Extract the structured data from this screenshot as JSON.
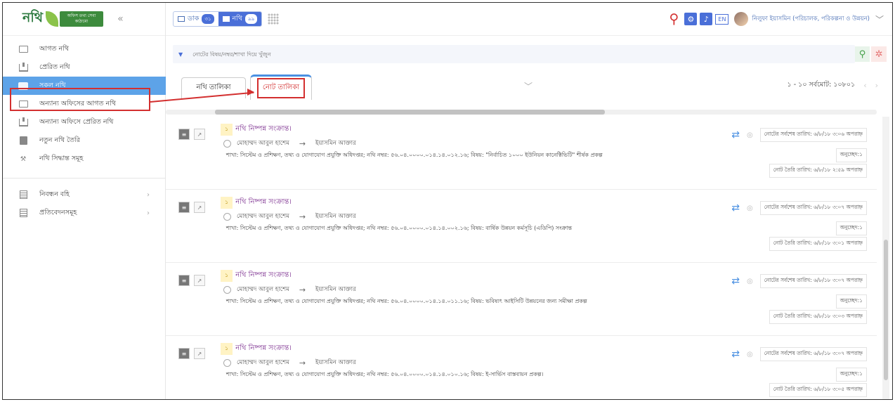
{
  "sidebar": {
    "logo_text": "নথি",
    "logo_badge": "অফিস তথ্য সেবা কাঠামো",
    "collapse": "«",
    "items": [
      {
        "label": "আগত নথি"
      },
      {
        "label": "প্রেরিত নথি"
      },
      {
        "label": "সকল নথি"
      },
      {
        "label": "অন্যান্য অফিসের আগত নথি"
      },
      {
        "label": "অন্যান্য অফিসে প্রেরিত নথি"
      },
      {
        "label": "নতুন নথি তৈরি"
      },
      {
        "label": "নথি সিদ্ধান্ত সমূহ"
      },
      {
        "label": "নিবন্ধন বহি"
      },
      {
        "label": "প্রতিবেদনসমূহ"
      }
    ]
  },
  "topbar": {
    "dak_label": "ডাক",
    "dak_count": "৩১",
    "nothi_label": "নথি",
    "nothi_count": "৯৯",
    "lang": "EN",
    "user": "নিলুফা ইয়াসমিন (পরিচালক, পরিকল্পনা ও উন্নয়ন)"
  },
  "search": {
    "placeholder": "নোটের বিষয়/নম্বর/শাখা দিয়ে খুঁজুন"
  },
  "tabs": {
    "nothi_list": "নথি তালিকা",
    "note_list": "নোট তালিকা"
  },
  "pager": {
    "text": "১ - ১০ সর্বমোট: ১০৮০১"
  },
  "rows": [
    {
      "num": "১",
      "title": "নথি নিষ্পন্ন সংক্রান্ত।",
      "from": "মোহাম্মদ আবুল হাশেম",
      "to": "ইয়াসমিন আক্তার",
      "desc": "শাখা: সিস্টেম ও প্রশিক্ষণ, তথ্য ও যোগাযোগ প্রযুক্তি অধিদপ্তর; নথি নম্বর: ৫৬.০৪.০০০০.০১৪.১৪.০১২.১৬; বিষয়: \"নির্বাচিত ১০০০ ইউনিয়ন কানেক্টিভিটি\" শীর্ষক প্রকল্প",
      "last_date": "নোটের সর্বশেষ তারিখ: ৬/৮/১৮ ৩:০৬ অপরাহ্ন",
      "onuchhed": "অনুচ্ছেদ:১",
      "created": "নোট তৈরি তারিখ: ৬/৮/১৮ ২:৫৯ অপরাহ্ন"
    },
    {
      "num": "১",
      "title": "নথি নিষ্পন্ন সংক্রান্ত।",
      "from": "মোহাম্মদ আবুল হাশেম",
      "to": "ইয়াসমিন আক্তার",
      "desc": "শাখা: সিস্টেম ও প্রশিক্ষণ, তথ্য ও যোগাযোগ প্রযুক্তি অধিদপ্তর; নথি নম্বর: ৫৬.০৪.০০০০.০১৪.১৪.০০২.১৬; বিষয়: বার্ষিক উন্নয়ন কর্মসূচি (এডিপি) সংক্রান্ত",
      "last_date": "নোটের সর্বশেষ তারিখ: ৬/৮/১৮ ৩:০৭ অপরাহ্ন",
      "onuchhed": "অনুচ্ছেদ:১",
      "created": "নোট তৈরি তারিখ: ৬/৮/১৮ ৩:০১ অপরাহ্ন"
    },
    {
      "num": "১",
      "title": "নথি নিষ্পন্ন সংক্রান্ত।",
      "from": "মোহাম্মদ আবুল হাশেম",
      "to": "ইয়াসমিন আক্তার",
      "desc": "শাখা: সিস্টেম ও প্রশিক্ষণ, তথ্য ও যোগাযোগ প্রযুক্তি অধিদপ্তর; নথি নম্বর: ৫৬.০৪.০০০০.০১৪.১৪.০১১.১৬; বিষয়: ভবিষ্যৎ আইসিটি উন্নয়নের জন্য সমীক্ষা প্রকল্প",
      "last_date": "নোটের সর্বশেষ তারিখ: ৬/৮/১৮ ৩:০৭ অপরাহ্ন",
      "onuchhed": "অনুচ্ছেদ:১",
      "created": "নোট তৈরি তারিখ: ৬/৮/১৮ ৩:০৩ অপরাহ্ন"
    },
    {
      "num": "১",
      "title": "নথি নিষ্পন্ন সংক্রান্ত।",
      "from": "মোহাম্মদ আবুল হাশেম",
      "to": "ইয়াসমিন আক্তার",
      "desc": "শাখা: সিস্টেম ও প্রশিক্ষণ, তথ্য ও যোগাযোগ প্রযুক্তি অধিদপ্তর; নথি নম্বর: ৫৬.০৪.০০০০.০১৪.১৪.০১০.১৬; বিষয়: ই-সার্ভিস বাস্তবায়ন প্রকল্প।",
      "last_date": "নোটের সর্বশেষ তারিখ: ৬/৮/১৮ ৩:০৭ অপরাহ্ন",
      "onuchhed": "অনুচ্ছেদ:১",
      "created": "নোট তৈরি তারিখ: ৬/৮/১৮ ৩:০৫ অপরাহ্ন"
    }
  ],
  "colors": {
    "accent": "#4a6fd8",
    "active_nav": "#5da3e8",
    "annotation_red": "#d32f2f",
    "title_purple": "#7b2d8e"
  }
}
